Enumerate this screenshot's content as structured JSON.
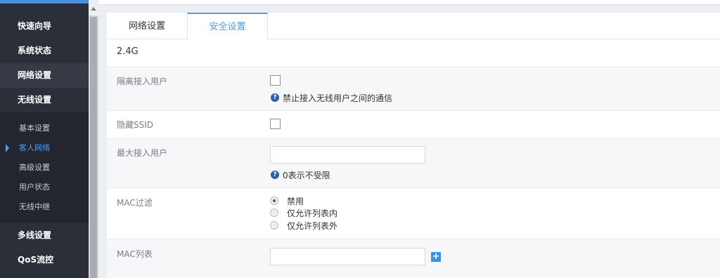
{
  "sidebar": {
    "main_items": [
      {
        "label": "快速向导"
      },
      {
        "label": "系统状态"
      },
      {
        "label": "网络设置"
      },
      {
        "label": "无线设置"
      },
      {
        "label": "多线设置"
      },
      {
        "label": "QoS流控"
      }
    ],
    "sub_items": [
      {
        "label": "基本设置"
      },
      {
        "label": "客人网络"
      },
      {
        "label": "高级设置"
      },
      {
        "label": "用户状态"
      },
      {
        "label": "无线中继"
      }
    ],
    "active_sub": "客人网络"
  },
  "tabs": [
    {
      "label": "网络设置"
    },
    {
      "label": "安全设置"
    }
  ],
  "active_tab": "安全设置",
  "section_title": "2.4G",
  "fields": {
    "isolate": {
      "label": "隔离接入用户",
      "checked": false,
      "hint": "禁止接入无线用户之间的通信"
    },
    "hide_ssid": {
      "label": "隐藏SSID",
      "checked": false
    },
    "max_users": {
      "label": "最大接入用户",
      "value": "",
      "hint": "0表示不受限"
    },
    "mac_filter": {
      "label": "MAC过滤",
      "options": [
        "禁用",
        "仅允许列表内",
        "仅允许列表外"
      ],
      "selected": "禁用"
    },
    "mac_list": {
      "label": "MAC列表",
      "value": "",
      "add_label": "+"
    }
  },
  "icons": {
    "hint": "question-circle-icon",
    "add": "plus-icon"
  },
  "colors": {
    "accent": "#4a9ff0",
    "sidebar_bg": "#2b2f38",
    "hint_icon": "#2b5fa8",
    "add_button": "#3d8fe0"
  }
}
